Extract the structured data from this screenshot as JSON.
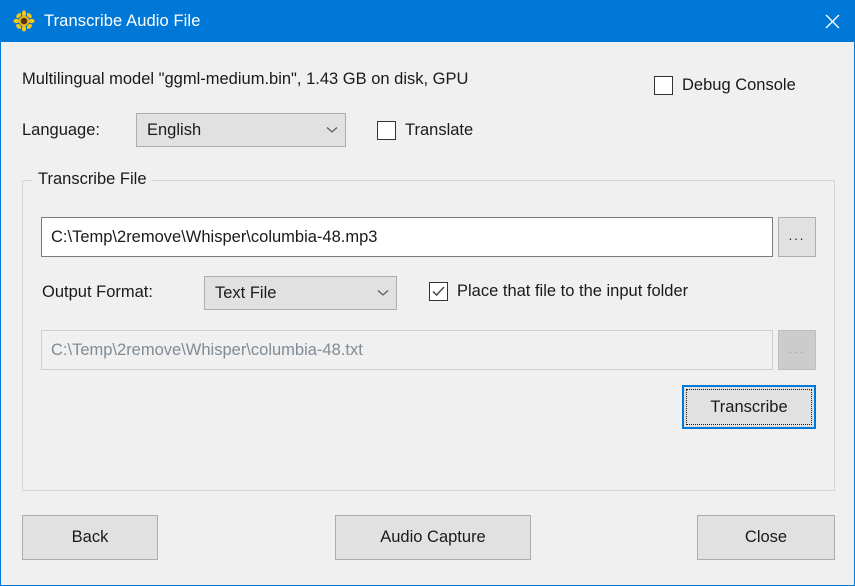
{
  "window": {
    "title": "Transcribe Audio File",
    "icon": "sunflower-icon",
    "close_icon": "close-icon",
    "accent_color": "#0078d7",
    "background_color": "#f0f0f0"
  },
  "model_info": "Multilingual model \"ggml-medium.bin\", 1.43 GB on disk, GPU",
  "debug_console": {
    "label": "Debug Console",
    "checked": false
  },
  "language": {
    "label": "Language:",
    "value": "English",
    "options": [
      "English"
    ]
  },
  "translate": {
    "label": "Translate",
    "checked": false
  },
  "transcribe_group": {
    "legend": "Transcribe File",
    "input_file": {
      "value": "C:\\Temp\\2remove\\Whisper\\columbia-48.mp3",
      "browse_label": "..."
    },
    "output_format": {
      "label": "Output Format:",
      "value": "Text File",
      "options": [
        "Text File"
      ]
    },
    "place_in_input_folder": {
      "label": "Place that file to the input folder",
      "checked": true
    },
    "output_file": {
      "value": "C:\\Temp\\2remove\\Whisper\\columbia-48.txt",
      "browse_label": "...",
      "disabled": true
    },
    "transcribe_button": {
      "label": "Transcribe",
      "focused": true
    }
  },
  "footer": {
    "back_label": "Back",
    "audio_capture_label": "Audio Capture",
    "close_label": "Close"
  }
}
